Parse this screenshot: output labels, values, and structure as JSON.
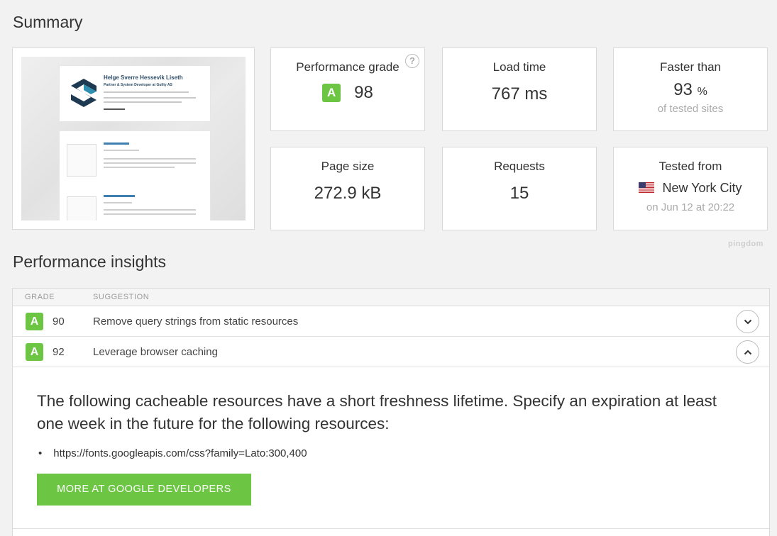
{
  "summary": {
    "title": "Summary",
    "thumbnail": {
      "name": "Helge Sverre Hessevik Liseth",
      "role": "Partner & System Developer at Guilty AS"
    },
    "performance_grade": {
      "label": "Performance grade",
      "grade": "A",
      "value": "98",
      "help_icon": "question-icon"
    },
    "load_time": {
      "label": "Load time",
      "value": "767 ms"
    },
    "faster_than": {
      "label": "Faster than",
      "value": "93",
      "unit": "%",
      "sub": "of tested sites"
    },
    "page_size": {
      "label": "Page size",
      "value": "272.9 kB"
    },
    "requests": {
      "label": "Requests",
      "value": "15"
    },
    "tested_from": {
      "label": "Tested from",
      "location": "New York City",
      "flag_icon": "us-flag-icon",
      "sub": "on Jun 12 at 20:22"
    },
    "brand": "pingdom"
  },
  "insights": {
    "title": "Performance insights",
    "columns": {
      "grade": "GRADE",
      "suggestion": "SUGGESTION"
    },
    "rows": [
      {
        "grade": "A",
        "score": "90",
        "suggestion": "Remove query strings from static resources",
        "expanded": false
      },
      {
        "grade": "A",
        "score": "92",
        "suggestion": "Leverage browser caching",
        "expanded": true
      }
    ],
    "detail": {
      "description": "The following cacheable resources have a short freshness lifetime. Specify an expiration at least one week in the future for the following resources:",
      "resources": [
        "https://fonts.googleapis.com/css?family=Lato:300,400"
      ],
      "button_label": "MORE AT GOOGLE DEVELOPERS"
    }
  },
  "colors": {
    "grade_green": "#6cc644",
    "border": "#d9d9d9",
    "background": "#f2f2f2"
  }
}
